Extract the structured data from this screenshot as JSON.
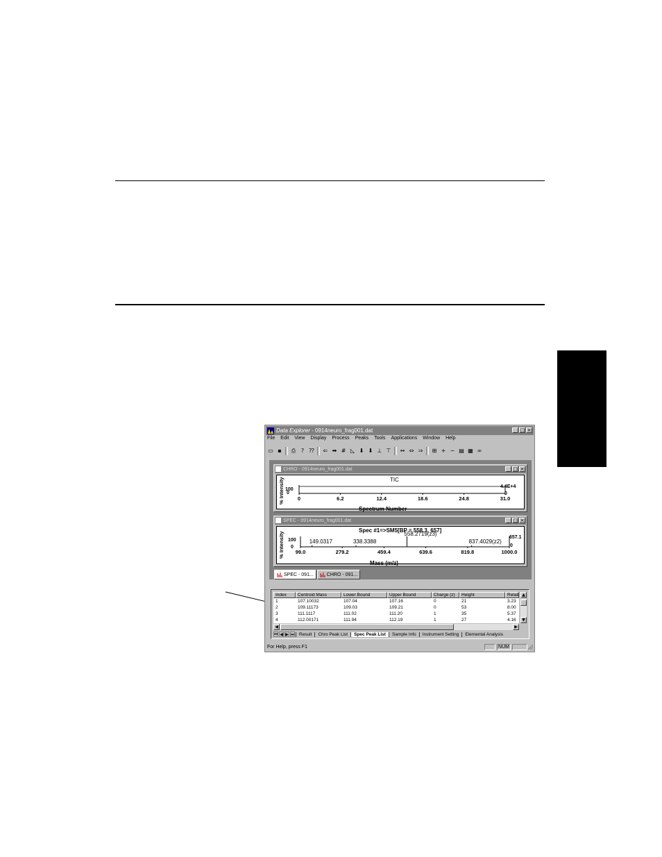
{
  "app": {
    "title_app": "Data Explorer",
    "title_file": " - 0914neuro_frag001.dat",
    "menu": [
      "File",
      "Edit",
      "View",
      "Display",
      "Process",
      "Peaks",
      "Tools",
      "Applications",
      "Window",
      "Help"
    ],
    "status": {
      "message": "For Help, press F1",
      "num": "NUM"
    },
    "toolbar_icons": [
      "open-icon",
      "save-icon",
      "print-icon",
      "help-icon",
      "context-help-icon",
      "arrow-left-icon",
      "arrow-right-icon",
      "hash-icon",
      "peak-label-icon",
      "arrow-down-icon",
      "arrow-down-2-icon",
      "label-icon",
      "label-2-icon",
      "range-icon",
      "zoom-out-icon",
      "zoom-in-icon",
      "expand-icon",
      "plus-icon",
      "minus-icon",
      "overlay-icon",
      "normalize-icon",
      "link-icon"
    ]
  },
  "chro": {
    "title": "CHRO - 0914neuro_frag001.dat",
    "label": "TIC",
    "ylabel": "% Intensity",
    "xlabel": "Spectrum Number",
    "y_top": "100",
    "y_bottom": "0",
    "right_top": "4.4E+4",
    "right_bottom": "0"
  },
  "spec": {
    "title": "SPEC - 0914neuro_frag001.dat",
    "header": "Spec #1=>SM5[BP = 558.3, 657]",
    "ylabel": "% Intensity",
    "xlabel": "Mass (m/z)",
    "y_top": "100",
    "y_bottom": "0",
    "right_top": "657.1",
    "right_bottom": "0",
    "peaks": [
      "149.0317",
      "338.3388",
      "558.2719(z3)",
      "837.4029(z2)"
    ]
  },
  "chart_data": [
    {
      "type": "line",
      "title": "TIC",
      "xlabel": "Spectrum Number",
      "ylabel": "% Intensity",
      "x_ticks": [
        "0",
        "6.2",
        "12.4",
        "18.6",
        "24.8",
        "31.0"
      ],
      "xlim": [
        0,
        31.0
      ],
      "ylim": [
        0,
        100
      ]
    },
    {
      "type": "bar",
      "title": "Spec #1=>SM5[BP = 558.3, 657]",
      "xlabel": "Mass (m/z)",
      "ylabel": "% Intensity",
      "x_ticks": [
        "99.0",
        "279.2",
        "459.4",
        "639.6",
        "819.8",
        "1000.0"
      ],
      "xlim": [
        99.0,
        1000.0
      ],
      "ylim": [
        0,
        100
      ],
      "peaks": [
        {
          "x": 149.0317,
          "label": "149.0317"
        },
        {
          "x": 338.3388,
          "label": "338.3388"
        },
        {
          "x": 558.2719,
          "label": "558.2719(z3)"
        },
        {
          "x": 837.4029,
          "label": "837.4029(z2)"
        }
      ]
    }
  ],
  "doc_tabs": [
    "SPEC - 091...",
    "CHRO - 091..."
  ],
  "peak_table": {
    "columns": [
      "Index",
      "Centroid Mass",
      "Lower Bound",
      "Upper Bound",
      "Charge (z)",
      "Height",
      "Relati"
    ],
    "rows": [
      [
        "1",
        "107.10032",
        "107.04",
        "107.16",
        "0",
        "21",
        "3.23"
      ],
      [
        "2",
        "109.11173",
        "109.03",
        "109.21",
        "0",
        "53",
        "8.00"
      ],
      [
        "3",
        "111.1117",
        "111.02",
        "111.20",
        "1",
        "35",
        "5.37"
      ],
      [
        "4",
        "112.00171",
        "111.94",
        "112.19",
        "1",
        "27",
        "4.16"
      ]
    ]
  },
  "sheet_tabs": [
    "Result",
    "Chro Peak List",
    "Spec Peak List",
    "Sample Info",
    "Instrument Setting",
    "Elemental Analysis"
  ],
  "active_sheet": "Spec Peak List"
}
